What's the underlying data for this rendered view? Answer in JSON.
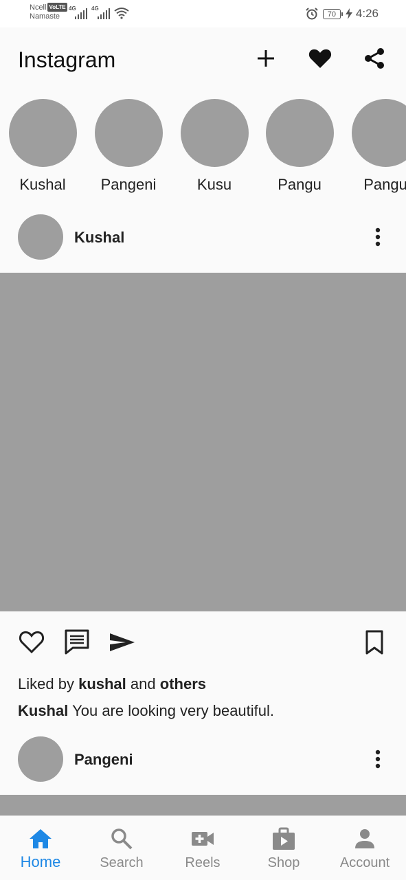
{
  "status_bar": {
    "carrier": "Ncell",
    "volte": "VoLTE",
    "network_name": "Namaste",
    "sig1": "4G",
    "sig2": "4G",
    "battery": "70",
    "time": "4:26"
  },
  "header": {
    "title": "Instagram"
  },
  "stories": [
    {
      "name": "Kushal"
    },
    {
      "name": "Pangeni"
    },
    {
      "name": "Kusu"
    },
    {
      "name": "Pangu"
    },
    {
      "name": "Pangu"
    }
  ],
  "posts": [
    {
      "username": "Kushal",
      "liked_prefix": "Liked by",
      "liked_user": "kushal",
      "liked_middle": "and",
      "liked_others": "others",
      "caption_user": "Kushal",
      "caption_text": "You are looking very beautiful."
    },
    {
      "username": "Pangeni"
    }
  ],
  "nav": [
    {
      "label": "Home",
      "icon": "home-icon"
    },
    {
      "label": "Search",
      "icon": "search-icon"
    },
    {
      "label": "Reels",
      "icon": "video-add-icon"
    },
    {
      "label": "Shop",
      "icon": "shop-icon"
    },
    {
      "label": "Account",
      "icon": "account-icon"
    }
  ],
  "colors": {
    "accent": "#1e88e5",
    "placeholder": "#9e9e9e",
    "inactive": "#8a8a8a"
  }
}
